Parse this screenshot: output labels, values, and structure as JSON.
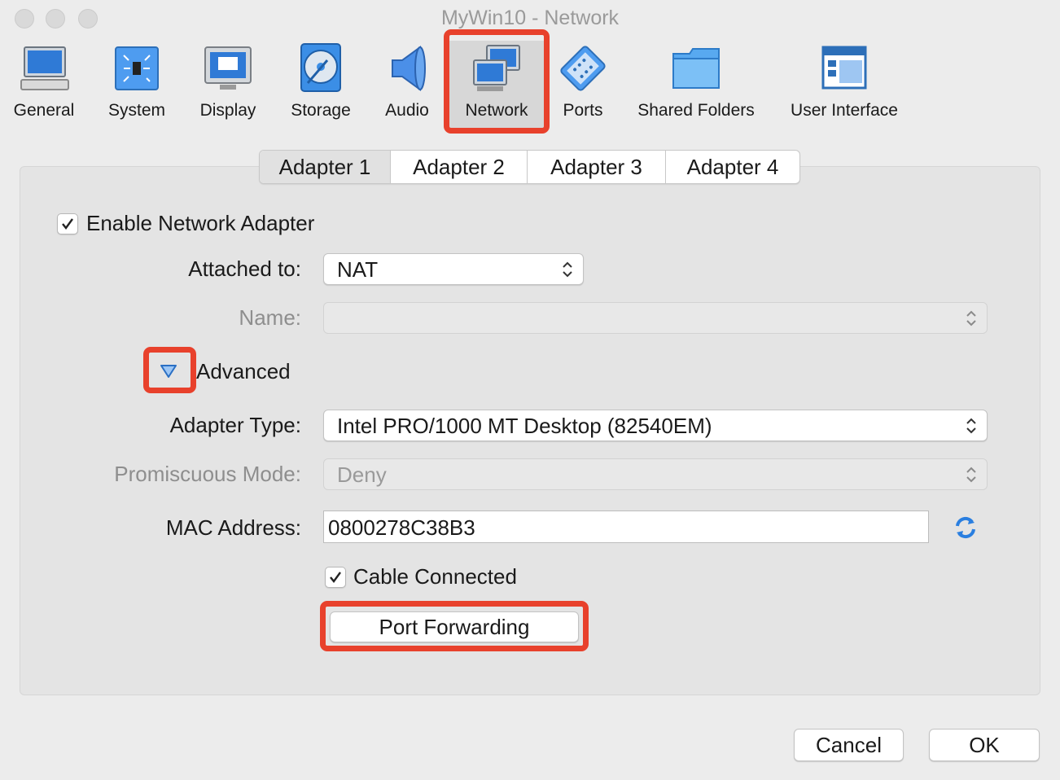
{
  "window": {
    "title": "MyWin10 - Network"
  },
  "toolbar": {
    "items": [
      {
        "label": "General",
        "icon": "monitor-icon"
      },
      {
        "label": "System",
        "icon": "chip-icon"
      },
      {
        "label": "Display",
        "icon": "display-icon"
      },
      {
        "label": "Storage",
        "icon": "disc-icon"
      },
      {
        "label": "Audio",
        "icon": "speaker-icon"
      },
      {
        "label": "Network",
        "icon": "network-icon",
        "selected": true
      },
      {
        "label": "Ports",
        "icon": "port-icon"
      },
      {
        "label": "Shared Folders",
        "icon": "folder-icon"
      },
      {
        "label": "User Interface",
        "icon": "window-icon"
      }
    ]
  },
  "tabs": [
    "Adapter 1",
    "Adapter 2",
    "Adapter 3",
    "Adapter 4"
  ],
  "form": {
    "enable_adapter": {
      "label": "Enable Network Adapter",
      "checked": true
    },
    "attached_to": {
      "label": "Attached to:",
      "value": "NAT"
    },
    "name": {
      "label": "Name:",
      "value": ""
    },
    "advanced": {
      "label": "Advanced",
      "expanded": true
    },
    "adapter_type": {
      "label": "Adapter Type:",
      "value": "Intel PRO/1000 MT Desktop (82540EM)"
    },
    "promiscuous_mode": {
      "label": "Promiscuous Mode:",
      "value": "Deny"
    },
    "mac_address": {
      "label": "MAC Address:",
      "value": "0800278C38B3"
    },
    "cable_connected": {
      "label": "Cable Connected",
      "checked": true
    },
    "port_forwarding": {
      "label": "Port Forwarding"
    }
  },
  "footer": {
    "cancel": "Cancel",
    "ok": "OK"
  },
  "colors": {
    "highlight": "#e8412c",
    "accent": "#1e7fe0"
  }
}
